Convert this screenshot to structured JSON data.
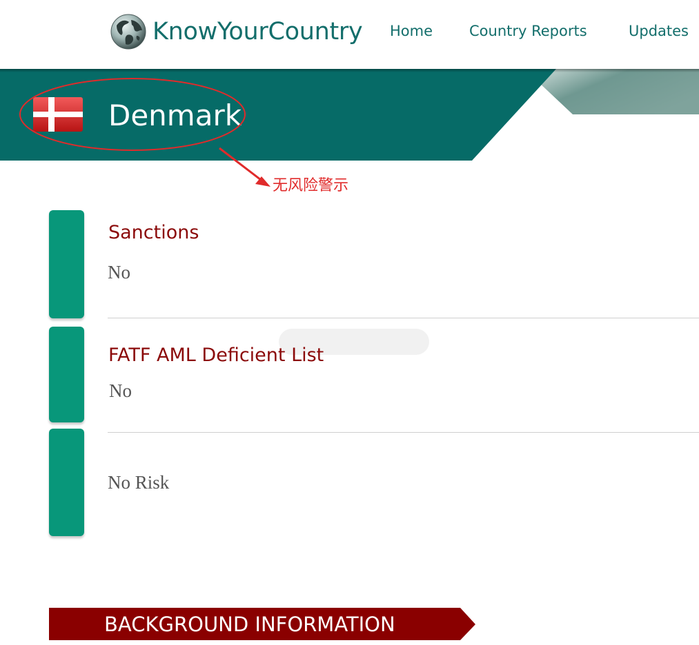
{
  "brand": {
    "name": "KnowYourCountry",
    "logo_icon": "globe-icon"
  },
  "nav": {
    "items": [
      {
        "label": "Home"
      },
      {
        "label": "Country Reports"
      },
      {
        "label": "Updates"
      }
    ]
  },
  "country": {
    "name": "Denmark",
    "flag_icon": "denmark-flag-icon"
  },
  "annotation": {
    "note": "无风险警示"
  },
  "risks": [
    {
      "title": "Sanctions",
      "value": "No"
    },
    {
      "title": "FATF AML Deficient List",
      "value": "No"
    },
    {
      "title": "",
      "value": "No Risk"
    }
  ],
  "section": {
    "label": "BACKGROUND INFORMATION"
  },
  "colors": {
    "brand_teal": "#136e6b",
    "banner_teal": "#066b67",
    "risk_bar_green": "#08977a",
    "heading_red": "#8b0a0a",
    "section_red": "#8a0000",
    "annotation_red": "#e02b2b"
  }
}
